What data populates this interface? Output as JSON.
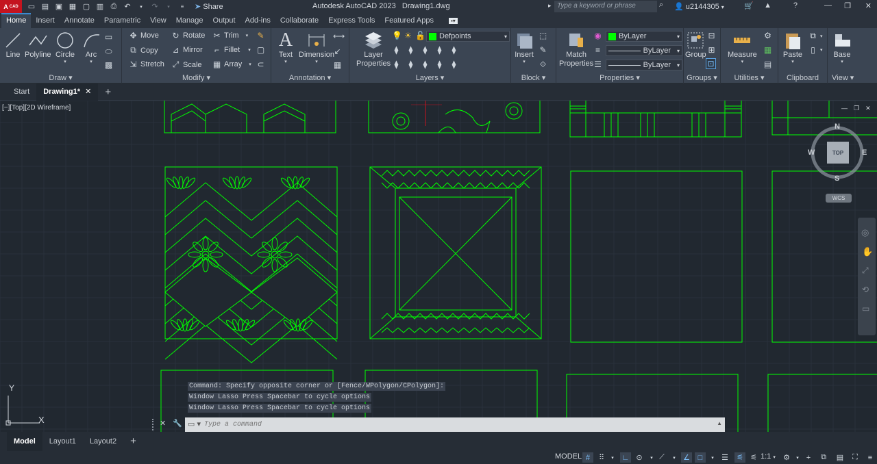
{
  "title_bar": {
    "app_title": "Autodesk AutoCAD 2023",
    "file_title": "Drawing1.dwg",
    "logo_text": "CAD",
    "share_label": "Share",
    "search_placeholder": "Type a keyword or phrase",
    "username": "u2144305"
  },
  "ribbon_tabs": [
    "Home",
    "Insert",
    "Annotate",
    "Parametric",
    "View",
    "Manage",
    "Output",
    "Add-ins",
    "Collaborate",
    "Express Tools",
    "Featured Apps"
  ],
  "active_ribbon_tab": "Home",
  "panels": {
    "draw": {
      "title": "Draw",
      "line": "Line",
      "polyline": "Polyline",
      "circle": "Circle",
      "arc": "Arc"
    },
    "modify": {
      "title": "Modify",
      "move": "Move",
      "rotate": "Rotate",
      "trim": "Trim",
      "copy": "Copy",
      "mirror": "Mirror",
      "fillet": "Fillet",
      "stretch": "Stretch",
      "scale": "Scale",
      "array": "Array"
    },
    "annotation": {
      "title": "Annotation",
      "text": "Text",
      "dimension": "Dimension"
    },
    "layers": {
      "title": "Layers",
      "layer_properties": "Layer\nProperties",
      "current_layer": "Defpoints"
    },
    "block": {
      "title": "Block",
      "insert": "Insert"
    },
    "properties": {
      "title": "Properties",
      "match_properties": "Match\nProperties",
      "color": "ByLayer",
      "linetype": "ByLayer",
      "lineweight": "ByLayer"
    },
    "groups": {
      "title": "Groups",
      "group": "Group"
    },
    "utilities": {
      "title": "Utilities",
      "measure": "Measure"
    },
    "clipboard": {
      "title": "Clipboard",
      "paste": "Paste"
    },
    "view": {
      "title": "View",
      "base": "Base"
    }
  },
  "file_tabs": {
    "start": "Start",
    "drawing": "Drawing1*"
  },
  "viewport": {
    "label": "[−][Top][2D Wireframe]",
    "viewcube": {
      "top": "TOP",
      "north": "N",
      "south": "S",
      "east": "E",
      "west": "W",
      "wcs": "WCS"
    },
    "ucs": {
      "x": "X",
      "y": "Y"
    }
  },
  "command": {
    "history": [
      "Command: Specify opposite corner or [Fence/WPolygon/CPolygon]:",
      "Window Lasso  Press Spacebar to cycle options",
      "Window Lasso  Press Spacebar to cycle options"
    ],
    "placeholder": "Type a command"
  },
  "layout_tabs": [
    "Model",
    "Layout1",
    "Layout2"
  ],
  "status": {
    "model": "MODEL",
    "scale": "1:1"
  },
  "colors": {
    "accent": "#3c8ad1",
    "drawing": "#00ff00",
    "canvas": "#212830",
    "ribbon": "#3b4553",
    "logo": "#c4141f"
  }
}
